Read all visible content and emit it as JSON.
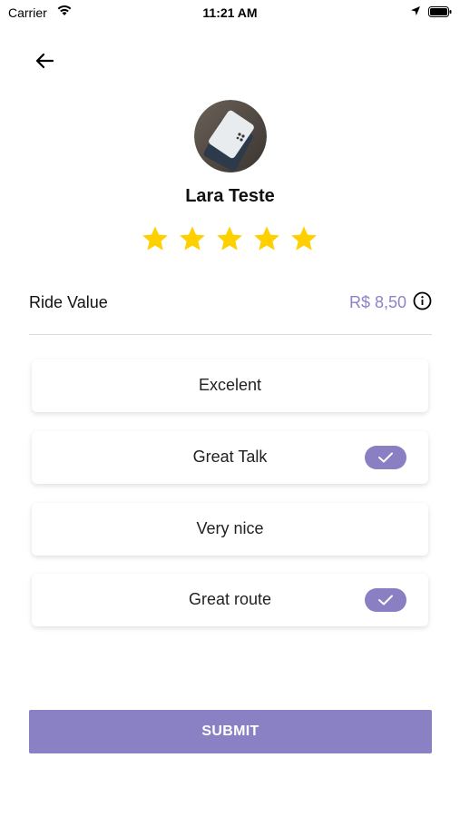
{
  "status_bar": {
    "carrier": "Carrier",
    "time": "11:21 AM"
  },
  "profile": {
    "name": "Lara Teste",
    "rating": 5,
    "rating_max": 5
  },
  "ride": {
    "label": "Ride Value",
    "value": "R$ 8,50"
  },
  "options": [
    {
      "label": "Excelent",
      "selected": false
    },
    {
      "label": "Great Talk",
      "selected": true
    },
    {
      "label": "Very nice",
      "selected": false
    },
    {
      "label": "Great route",
      "selected": true
    }
  ],
  "submit_label": "SUBMIT",
  "colors": {
    "accent": "#8a80c4",
    "star": "#ffd000",
    "value_text": "#8e82c7"
  }
}
